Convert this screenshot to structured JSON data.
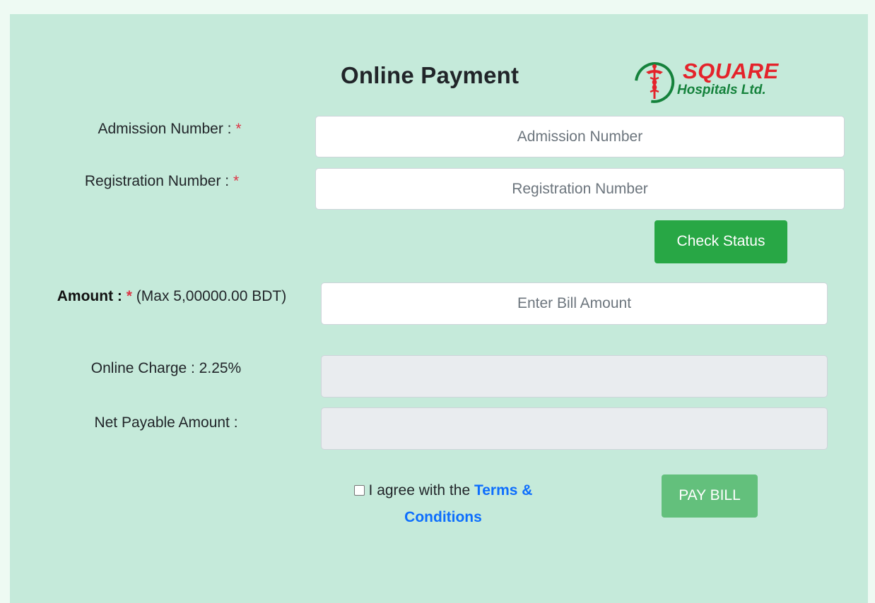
{
  "header": {
    "title": "Online Payment",
    "logo_line1": "SQUARE",
    "logo_line2": "Hospitals Ltd."
  },
  "form": {
    "admission": {
      "label": "Admission Number :",
      "required_mark": "*",
      "placeholder": "Admission Number",
      "value": ""
    },
    "registration": {
      "label": "Registration Number :",
      "required_mark": "*",
      "placeholder": "Registration Number",
      "value": ""
    },
    "check_status_label": "Check Status",
    "amount": {
      "label": "Amount :",
      "required_mark": "*",
      "note": "(Max 5,00000.00 BDT)",
      "placeholder": "Enter Bill Amount",
      "value": ""
    },
    "online_charge": {
      "label": "Online Charge : 2.25%",
      "value": ""
    },
    "net_payable": {
      "label": "Net Payable Amount :",
      "value": ""
    },
    "agree": {
      "text": "I agree with the",
      "link_text": "Terms & Conditions",
      "checked": false
    },
    "pay_bill_label": "PAY BILL"
  },
  "colors": {
    "page_bg": "#eefaf3",
    "panel_bg": "#c5eada",
    "primary_green": "#28a745",
    "disabled_green": "#63c07c",
    "required_red": "#dc3545",
    "link_blue": "#0d6efd",
    "logo_red": "#e4232b",
    "logo_green": "#15823c"
  }
}
